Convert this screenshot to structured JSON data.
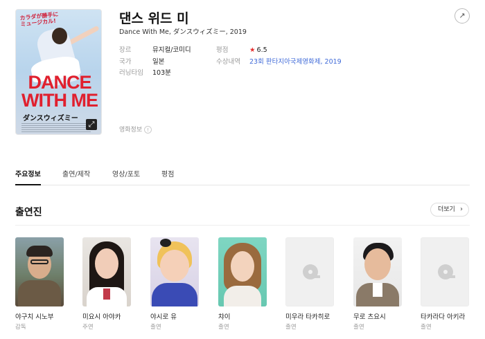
{
  "movie": {
    "title": "댄스 위드 미",
    "subtitle": "Dance With Me, ダンスウィズミー, 2019",
    "poster": {
      "tagline_line1": "カラダが勝手に",
      "tagline_line2": "ミュージカル!",
      "title_line1": "DANCE",
      "title_line2": "WITH ME",
      "title_jp": "ダンスウィズミー"
    },
    "info": [
      {
        "key": "장르",
        "value": "뮤지컬/코미디"
      },
      {
        "key": "국가",
        "value": "일본"
      },
      {
        "key": "러닝타임",
        "value": "103분"
      },
      {
        "key": "평점",
        "value": "6.5"
      },
      {
        "key": "수상내역",
        "value": "23회 판타지아국제영화제, 2019"
      }
    ],
    "info_label": "영화정보"
  },
  "share_icon": "share-icon",
  "tabs": [
    {
      "label": "주요정보",
      "active": true
    },
    {
      "label": "출연/제작"
    },
    {
      "label": "영상/포토"
    },
    {
      "label": "평점"
    }
  ],
  "cast_section": {
    "title": "출연진",
    "more_label": "더보기",
    "members": [
      {
        "name": "야구치 시노부",
        "role": "감독"
      },
      {
        "name": "미요시 아야카",
        "role": "주연"
      },
      {
        "name": "야시로 유",
        "role": "출연"
      },
      {
        "name": "챠이",
        "role": "출연"
      },
      {
        "name": "미우라 타카히로",
        "role": "출연"
      },
      {
        "name": "무로 츠요시",
        "role": "출연"
      },
      {
        "name": "타카라다 아키라",
        "role": "출연"
      }
    ]
  },
  "colors": {
    "rating_star": "#e52c2c",
    "link": "#3f6ad8",
    "poster_title": "#e0202e"
  }
}
